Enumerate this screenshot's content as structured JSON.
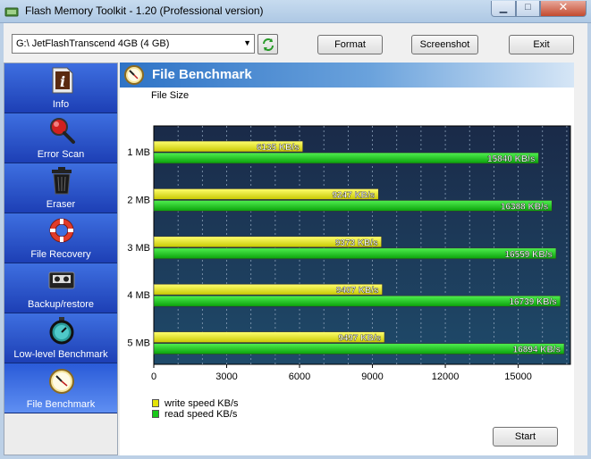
{
  "window": {
    "title": "Flash Memory Toolkit - 1.20 (Professional version)"
  },
  "toolbar": {
    "drive_value": "G:\\ JetFlashTranscend 4GB (4 GB)",
    "format_label": "Format",
    "screenshot_label": "Screenshot",
    "exit_label": "Exit"
  },
  "sidebar": {
    "items": [
      {
        "label": "Info",
        "icon": "info-icon"
      },
      {
        "label": "Error Scan",
        "icon": "magnifier-icon"
      },
      {
        "label": "Eraser",
        "icon": "trash-icon"
      },
      {
        "label": "File Recovery",
        "icon": "lifebuoy-icon"
      },
      {
        "label": "Backup/restore",
        "icon": "tape-icon"
      },
      {
        "label": "Low-level Benchmark",
        "icon": "stopwatch-icon"
      },
      {
        "label": "File Benchmark",
        "icon": "clock-icon",
        "active": true
      }
    ]
  },
  "panel": {
    "title": "File Benchmark",
    "start_label": "Start"
  },
  "chart_data": {
    "type": "bar",
    "orientation": "horizontal",
    "ylabel": "File Size",
    "categories": [
      "1 MB",
      "2 MB",
      "3 MB",
      "4 MB",
      "5 MB"
    ],
    "series": [
      {
        "name": "write speed KB/s",
        "color": "#e3e308",
        "values": [
          6135,
          9247,
          9373,
          9407,
          9497
        ],
        "labels": [
          "6135 KB/s",
          "9247 KB/s",
          "9373 KB/s",
          "9407 KB/s",
          "9497 KB/s"
        ]
      },
      {
        "name": "read speed KB/s",
        "color": "#18c818",
        "values": [
          15840,
          16388,
          16559,
          16739,
          16894
        ],
        "labels": [
          "15840 KB/s",
          "16388 KB/s",
          "16559 KB/s",
          "16739 KB/s",
          "16894 KB/s"
        ]
      }
    ],
    "xticks": [
      0,
      3000,
      6000,
      9000,
      12000,
      15000
    ],
    "xtick_labels": [
      "0",
      "3000",
      "6000",
      "9000",
      "12000",
      "15000"
    ],
    "xlim": [
      0,
      17150
    ],
    "grid": true,
    "legend": "bottom-left",
    "background": "#1a3656"
  }
}
